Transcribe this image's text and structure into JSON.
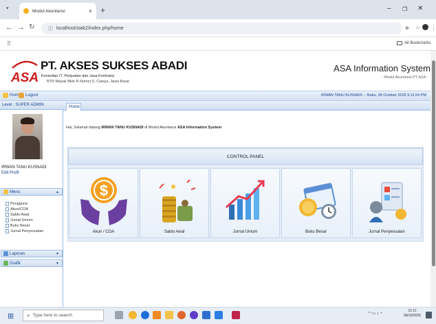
{
  "browser": {
    "tab_title": "Modul Akuntansi",
    "url": "localhost/siak2/index.php/home",
    "all_bookmarks": "All Bookmarks"
  },
  "app": {
    "logo_text": "ASA",
    "company_name": "PT. AKSES SUKSES ABADI",
    "tagline": "Konsultan IT, Penjualan dan Jasa Kontruksi",
    "address": "BTN Mayak Blok R Nomor 5, Cianjur, Jawa Barat",
    "system_name": "ASA Information System",
    "system_sub": ": Modul Akuntansi PT ASA :"
  },
  "toolbar": {
    "home": "Home",
    "logout": "Logout",
    "user_stamp": "IRWAN TANU KUSNADI -- Rabu, 08 October 2025 9:11:54 PM"
  },
  "sidebar": {
    "level": "Level : SUPER ADMIN",
    "user_name": "IRWAN TANU KUSNADI",
    "edit_profile": "Edit Profil",
    "menu_header": "Menu",
    "menu_items": [
      "Pengguna",
      "Akun/COA",
      "Saldo Awal",
      "Jurnal Umum",
      "Buku Besar",
      "Jurnal Penyesuaian"
    ],
    "laporan": "Laporan",
    "grafik": "Grafik"
  },
  "main": {
    "tab": "Home",
    "welcome_prefix": "Hai, Selamat datang ",
    "welcome_user": "IRWAN TANU KUSNADI",
    "welcome_mid": " di Modul Akuntansi ",
    "welcome_sys": "ASA Information System",
    "control_panel_title": "CONTROL PANEL",
    "cards": [
      "Akun / COA",
      "Saldo Awal",
      "Jurnal Umum",
      "Buku Besar",
      "Jurnal Penyesuaian"
    ]
  },
  "taskbar": {
    "search_placeholder": "Type here to search",
    "time": "21:11",
    "date": "08/10/2025"
  }
}
